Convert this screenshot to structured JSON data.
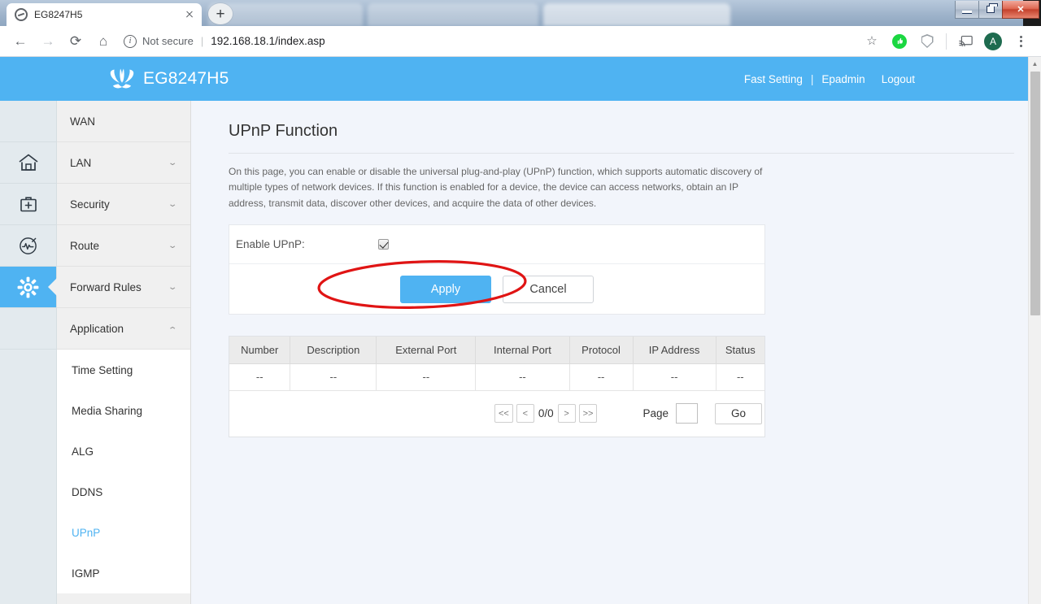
{
  "browser": {
    "tabs": [
      {
        "title": "EG8247H5",
        "active": true,
        "blurred": false
      },
      {
        "title": "",
        "active": false,
        "blurred": true
      },
      {
        "title": "",
        "active": false,
        "blurred": true
      },
      {
        "title": "",
        "active": false,
        "blurred": true
      }
    ],
    "new_tab_label": "+",
    "nav": {
      "back_icon": "←",
      "forward_icon": "→",
      "reload_icon": "⟳",
      "home_icon": "⌂"
    },
    "omnibox": {
      "info_icon": "i",
      "security_label": "Not secure",
      "divider": "|",
      "url": "192.168.18.1/index.asp"
    },
    "actions": {
      "bookmark_icon": "☆",
      "extension_green_icon": "👍",
      "adblock_shield_icon": "shield",
      "cast_icon": "cast",
      "avatar_letter": "A",
      "menu_icon": "⋮"
    },
    "window_controls": {
      "minimize": "—",
      "restore": "❐",
      "close": "✕"
    }
  },
  "router": {
    "brand": "EG8247H5",
    "header_nav": {
      "fast_setting": "Fast Setting",
      "separator": "|",
      "account": "Epadmin",
      "logout": "Logout"
    },
    "rail": [
      {
        "icon": "blank",
        "active": false
      },
      {
        "icon": "home-icon",
        "active": false
      },
      {
        "icon": "toolbox-icon",
        "active": false
      },
      {
        "icon": "diagnostics-icon",
        "active": false
      },
      {
        "icon": "gear-icon",
        "active": true
      }
    ],
    "menu": [
      {
        "label": "WAN",
        "expandable": false,
        "expanded": false
      },
      {
        "label": "LAN",
        "expandable": true,
        "expanded": false
      },
      {
        "label": "Security",
        "expandable": true,
        "expanded": false
      },
      {
        "label": "Route",
        "expandable": true,
        "expanded": false
      },
      {
        "label": "Forward Rules",
        "expandable": true,
        "expanded": false
      },
      {
        "label": "Application",
        "expandable": true,
        "expanded": true
      }
    ],
    "submenu": [
      {
        "label": "Time Setting",
        "active": false
      },
      {
        "label": "Media Sharing",
        "active": false
      },
      {
        "label": "ALG",
        "active": false
      },
      {
        "label": "DDNS",
        "active": false
      },
      {
        "label": "UPnP",
        "active": true
      },
      {
        "label": "IGMP",
        "active": false
      }
    ],
    "page": {
      "title": "UPnP Function",
      "description": "On this page, you can enable or disable the universal plug-and-play (UPnP) function, which supports automatic discovery of multiple types of network devices. If this function is enabled for a device, the device can access networks, obtain an IP address, transmit data, discover other devices, and acquire the data of other devices.",
      "form": {
        "enable_label": "Enable UPnP:",
        "enable_checked": true
      },
      "buttons": {
        "apply": "Apply",
        "cancel": "Cancel"
      },
      "table": {
        "headers": [
          "Number",
          "Description",
          "External Port",
          "Internal Port",
          "Protocol",
          "IP Address",
          "Status"
        ],
        "rows": [
          [
            "--",
            "--",
            "--",
            "--",
            "--",
            "--",
            "--"
          ]
        ]
      },
      "pagination": {
        "first": "<<",
        "prev": "<",
        "counter": "0/0",
        "next": ">",
        "last": ">>",
        "page_label": "Page",
        "page_value": "",
        "go": "Go"
      }
    }
  },
  "colors": {
    "accent": "#4fb3f2",
    "annotation": "#e01414",
    "content_bg": "#f2f5fb",
    "rail_bg": "#e3eaee"
  }
}
